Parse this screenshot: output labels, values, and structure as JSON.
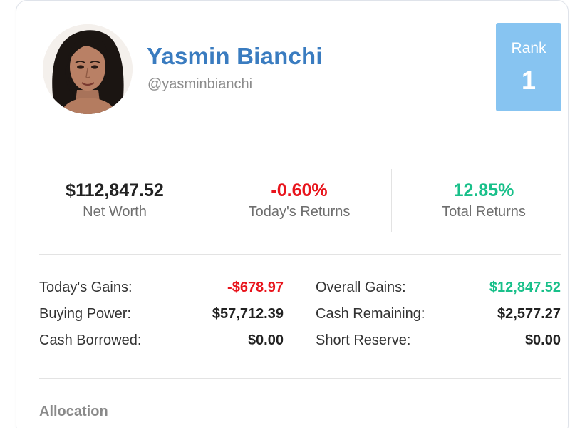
{
  "profile": {
    "name": "Yasmin Bianchi",
    "handle": "@yasminbianchi",
    "avatar_icon": "user-portrait"
  },
  "rank": {
    "label": "Rank",
    "value": "1",
    "color": "#87c4f1"
  },
  "stats": [
    {
      "value": "$112,847.52",
      "label": "Net Worth",
      "color": "#222222"
    },
    {
      "value": "-0.60%",
      "label": "Today's Returns",
      "color": "#e8141c"
    },
    {
      "value": "12.85%",
      "label": "Total Returns",
      "color": "#19c08a"
    }
  ],
  "details": {
    "left": [
      {
        "label": "Today's Gains:",
        "value": "-$678.97",
        "color": "#e8141c"
      },
      {
        "label": "Buying Power:",
        "value": "$57,712.39",
        "color": "#222222"
      },
      {
        "label": "Cash Borrowed:",
        "value": "$0.00",
        "color": "#222222"
      }
    ],
    "right": [
      {
        "label": "Overall Gains:",
        "value": "$12,847.52",
        "color": "#19c08a"
      },
      {
        "label": "Cash Remaining:",
        "value": "$2,577.27",
        "color": "#222222"
      },
      {
        "label": "Short Reserve:",
        "value": "$0.00",
        "color": "#222222"
      }
    ]
  },
  "allocation": {
    "title": "Allocation"
  },
  "colors": {
    "name": "#3a7cc0",
    "negative": "#e8141c",
    "positive": "#19c08a"
  }
}
